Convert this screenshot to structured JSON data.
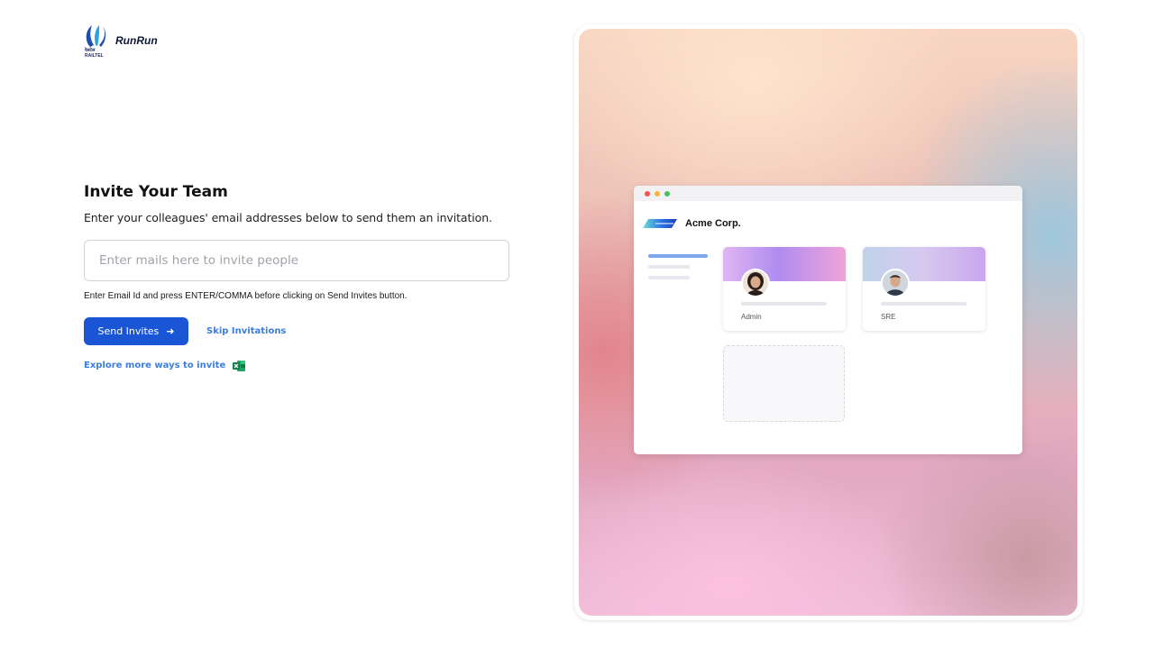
{
  "brand": {
    "logo_text": "रेलटेल RAILTEL",
    "name": "RunRun"
  },
  "form": {
    "title": "Invite Your Team",
    "subtitle": "Enter your colleagues' email addresses below to send them an invitation.",
    "email_placeholder": "Enter mails here to invite people",
    "email_value": "",
    "hint": "Enter Email Id and press ENTER/COMMA before clicking on Send Invites button.",
    "send_label": "Send Invites",
    "skip_label": "Skip Invitations",
    "explore_label": "Explore more ways to invite",
    "explore_icon": "excel-icon",
    "accent_color": "#1a55d6",
    "link_color": "#3b7de0"
  },
  "illustration": {
    "company_name": "Acme Corp.",
    "cards": [
      {
        "role": "Admin"
      },
      {
        "role": "SRE"
      }
    ]
  }
}
